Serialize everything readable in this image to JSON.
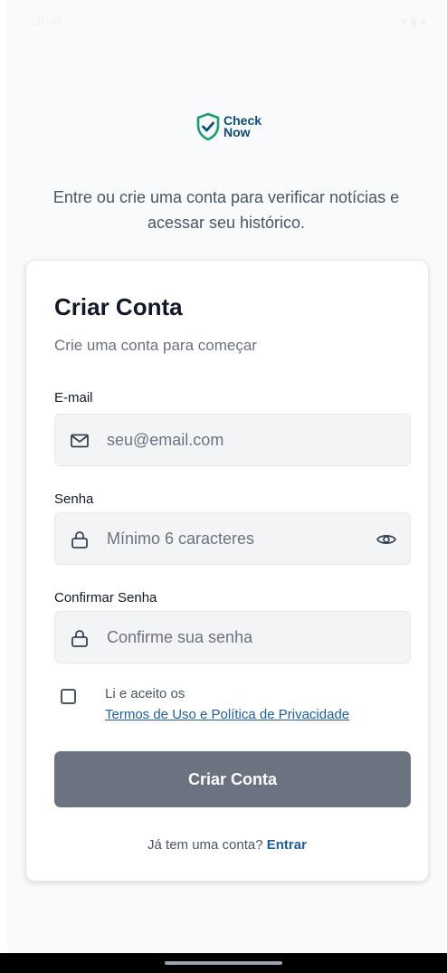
{
  "status_bar": {
    "time": "10:00",
    "icons": "▾ ▮ ●"
  },
  "logo": {
    "line1": "Check",
    "line2": "Now",
    "brand_color": "#0f4c75",
    "accent_color": "#1a9c6b"
  },
  "tagline": "Entre ou crie uma conta para verificar notícias e acessar seu histórico.",
  "card": {
    "title": "Criar Conta",
    "subtitle": "Crie uma conta para começar"
  },
  "fields": {
    "email": {
      "label": "E-mail",
      "placeholder": "seu@email.com",
      "value": "",
      "icon": "mail-icon"
    },
    "password": {
      "label": "Senha",
      "placeholder": "Mínimo 6 caracteres",
      "value": "",
      "icon": "lock-icon",
      "toggle_icon": "eye-icon"
    },
    "confirm_password": {
      "label": "Confirmar Senha",
      "placeholder": "Confirme sua senha",
      "value": "",
      "icon": "lock-icon"
    }
  },
  "terms": {
    "checked": false,
    "text": "Li e aceito os",
    "link": "Termos de Uso e Política de Privacidade"
  },
  "submit_button": {
    "label": "Criar Conta",
    "color": "#6b7280"
  },
  "login": {
    "prompt": "Já tem uma conta?",
    "link": "Entrar"
  }
}
